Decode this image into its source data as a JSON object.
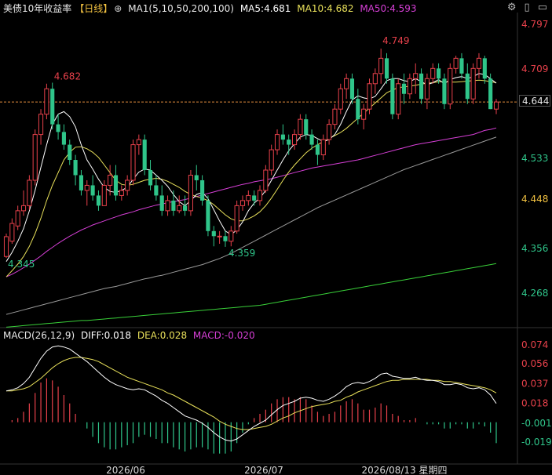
{
  "header": {
    "title": "美债10年收益率",
    "period": "【日线】",
    "ma_label": "MA1(5,10,50,200,100)",
    "ma5": "MA5:4.681",
    "ma10": "MA10:4.682",
    "ma50": "MA50:4.593"
  },
  "toolbar": {
    "settings_icon": "gear-icon",
    "toggle_icon": "panel-toggle-icon",
    "expand_icon": "expand-icon"
  },
  "macd_header": {
    "label": "MACD(26,12,9)",
    "diff": "DIFF:0.018",
    "dea": "DEA:0.028",
    "macd": "MACD:-0.020"
  },
  "last_price_tag": "4.644",
  "lower_tag": "4.448",
  "annotations": {
    "high1": "4.682",
    "low1": "4.345",
    "low2": "4.359",
    "high2": "4.749"
  },
  "x_labels": [
    "2026/06",
    "2026/07",
    "2026/08/13 星期四"
  ],
  "colors": {
    "up": "#e8414b",
    "down": "#2fc58a",
    "ma5": "#ffffff",
    "ma10": "#e8e05a",
    "ma50": "#d63fd6",
    "ma200": "#9a9a9a",
    "ma100": "#39d039",
    "dea": "#e8e05a",
    "diff": "#ffffff",
    "axis_up": "#e8414b",
    "axis_down": "#2fc58a"
  },
  "chart_data": [
    {
      "type": "candlestick",
      "title": "美债10年收益率",
      "y_ticks": [
        4.797,
        4.709,
        4.644,
        4.533,
        4.448,
        4.356,
        4.268
      ],
      "ylim": [
        4.2,
        4.82
      ],
      "reference_line": 4.644,
      "ohlc": [
        [
          4.34,
          4.385,
          4.337,
          4.379
        ],
        [
          4.37,
          4.415,
          4.365,
          4.405
        ],
        [
          4.4,
          4.44,
          4.392,
          4.43
        ],
        [
          4.43,
          4.47,
          4.42,
          4.44
        ],
        [
          4.44,
          4.5,
          4.432,
          4.49
        ],
        [
          4.49,
          4.59,
          4.48,
          4.58
        ],
        [
          4.58,
          4.63,
          4.56,
          4.62
        ],
        [
          4.62,
          4.68,
          4.61,
          4.67
        ],
        [
          4.67,
          4.682,
          4.59,
          4.6
        ],
        [
          4.6,
          4.62,
          4.57,
          4.585
        ],
        [
          4.585,
          4.6,
          4.55,
          4.56
        ],
        [
          4.56,
          4.57,
          4.52,
          4.53
        ],
        [
          4.53,
          4.54,
          4.48,
          4.5
        ],
        [
          4.5,
          4.51,
          4.46,
          4.47
        ],
        [
          4.47,
          4.49,
          4.44,
          4.48
        ],
        [
          4.48,
          4.5,
          4.45,
          4.46
        ],
        [
          4.46,
          4.47,
          4.43,
          4.44
        ],
        [
          4.44,
          4.49,
          4.44,
          4.48
        ],
        [
          4.48,
          4.52,
          4.46,
          4.5
        ],
        [
          4.5,
          4.52,
          4.45,
          4.46
        ],
        [
          4.46,
          4.48,
          4.45,
          4.47
        ],
        [
          4.47,
          4.5,
          4.46,
          4.49
        ],
        [
          4.49,
          4.57,
          4.48,
          4.56
        ],
        [
          4.56,
          4.58,
          4.54,
          4.57
        ],
        [
          4.57,
          4.58,
          4.5,
          4.51
        ],
        [
          4.51,
          4.53,
          4.47,
          4.48
        ],
        [
          4.48,
          4.5,
          4.45,
          4.46
        ],
        [
          4.46,
          4.48,
          4.42,
          4.43
        ],
        [
          4.43,
          4.46,
          4.42,
          4.45
        ],
        [
          4.45,
          4.47,
          4.42,
          4.43
        ],
        [
          4.43,
          4.46,
          4.425,
          4.44
        ],
        [
          4.44,
          4.46,
          4.42,
          4.43
        ],
        [
          4.43,
          4.51,
          4.42,
          4.5
        ],
        [
          4.5,
          4.52,
          4.47,
          4.49
        ],
        [
          4.49,
          4.5,
          4.44,
          4.45
        ],
        [
          4.45,
          4.46,
          4.38,
          4.39
        ],
        [
          4.39,
          4.4,
          4.36,
          4.38
        ],
        [
          4.38,
          4.39,
          4.365,
          4.38
        ],
        [
          4.38,
          4.39,
          4.359,
          4.37
        ],
        [
          4.37,
          4.4,
          4.36,
          4.39
        ],
        [
          4.39,
          4.45,
          4.385,
          4.44
        ],
        [
          4.44,
          4.46,
          4.43,
          4.45
        ],
        [
          4.45,
          4.47,
          4.44,
          4.46
        ],
        [
          4.46,
          4.47,
          4.44,
          4.45
        ],
        [
          4.45,
          4.48,
          4.44,
          4.47
        ],
        [
          4.47,
          4.52,
          4.465,
          4.51
        ],
        [
          4.51,
          4.56,
          4.5,
          4.55
        ],
        [
          4.55,
          4.59,
          4.54,
          4.58
        ],
        [
          4.58,
          4.6,
          4.56,
          4.57
        ],
        [
          4.57,
          4.58,
          4.54,
          4.56
        ],
        [
          4.56,
          4.59,
          4.55,
          4.58
        ],
        [
          4.58,
          4.62,
          4.57,
          4.61
        ],
        [
          4.61,
          4.62,
          4.57,
          4.58
        ],
        [
          4.58,
          4.59,
          4.55,
          4.56
        ],
        [
          4.56,
          4.57,
          4.52,
          4.54
        ],
        [
          4.54,
          4.58,
          4.53,
          4.57
        ],
        [
          4.57,
          4.61,
          4.56,
          4.6
        ],
        [
          4.6,
          4.64,
          4.59,
          4.63
        ],
        [
          4.63,
          4.68,
          4.62,
          4.67
        ],
        [
          4.67,
          4.7,
          4.65,
          4.69
        ],
        [
          4.69,
          4.7,
          4.64,
          4.65
        ],
        [
          4.65,
          4.67,
          4.6,
          4.61
        ],
        [
          4.61,
          4.64,
          4.59,
          4.63
        ],
        [
          4.63,
          4.69,
          4.62,
          4.68
        ],
        [
          4.68,
          4.71,
          4.66,
          4.7
        ],
        [
          4.7,
          4.749,
          4.68,
          4.73
        ],
        [
          4.73,
          4.74,
          4.68,
          4.69
        ],
        [
          4.69,
          4.7,
          4.61,
          4.62
        ],
        [
          4.62,
          4.69,
          4.61,
          4.68
        ],
        [
          4.68,
          4.7,
          4.64,
          4.66
        ],
        [
          4.66,
          4.7,
          4.65,
          4.69
        ],
        [
          4.69,
          4.72,
          4.66,
          4.7
        ],
        [
          4.7,
          4.71,
          4.64,
          4.65
        ],
        [
          4.65,
          4.7,
          4.63,
          4.69
        ],
        [
          4.69,
          4.72,
          4.68,
          4.71
        ],
        [
          4.71,
          4.72,
          4.68,
          4.69
        ],
        [
          4.69,
          4.7,
          4.63,
          4.64
        ],
        [
          4.64,
          4.72,
          4.63,
          4.71
        ],
        [
          4.71,
          4.735,
          4.7,
          4.73
        ],
        [
          4.73,
          4.74,
          4.69,
          4.7
        ],
        [
          4.7,
          4.72,
          4.64,
          4.65
        ],
        [
          4.65,
          4.72,
          4.64,
          4.71
        ],
        [
          4.71,
          4.74,
          4.69,
          4.73
        ],
        [
          4.73,
          4.735,
          4.68,
          4.69
        ],
        [
          4.69,
          4.7,
          4.63,
          4.63
        ],
        [
          4.63,
          4.65,
          4.62,
          4.644
        ]
      ],
      "ma5": [
        4.33,
        4.348,
        4.37,
        4.395,
        4.43,
        4.47,
        4.515,
        4.56,
        4.6,
        4.62,
        4.625,
        4.615,
        4.595,
        4.56,
        4.53,
        4.512,
        4.492,
        4.476,
        4.468,
        4.466,
        4.47,
        4.476,
        4.492,
        4.506,
        4.512,
        4.51,
        4.5,
        4.49,
        4.478,
        4.462,
        4.448,
        4.44,
        4.45,
        4.462,
        4.466,
        4.454,
        4.432,
        4.41,
        4.39,
        4.383,
        4.392,
        4.408,
        4.43,
        4.445,
        4.455,
        4.47,
        4.49,
        4.51,
        4.53,
        4.548,
        4.562,
        4.575,
        4.58,
        4.578,
        4.572,
        4.566,
        4.57,
        4.58,
        4.6,
        4.625,
        4.648,
        4.656,
        4.652,
        4.65,
        4.655,
        4.67,
        4.686,
        4.69,
        4.69,
        4.686,
        4.684,
        4.69,
        4.684,
        4.678,
        4.682,
        4.688,
        4.68,
        4.688,
        4.692,
        4.694,
        4.69,
        4.694,
        4.7,
        4.698,
        4.69,
        4.681
      ],
      "ma10": [
        4.3,
        4.312,
        4.325,
        4.34,
        4.36,
        4.385,
        4.415,
        4.45,
        4.48,
        4.505,
        4.53,
        4.545,
        4.555,
        4.556,
        4.552,
        4.545,
        4.535,
        4.52,
        4.505,
        4.49,
        4.482,
        4.48,
        4.482,
        4.486,
        4.49,
        4.492,
        4.494,
        4.492,
        4.488,
        4.482,
        4.476,
        4.468,
        4.462,
        4.458,
        4.455,
        4.45,
        4.442,
        4.432,
        4.422,
        4.414,
        4.41,
        4.41,
        4.414,
        4.42,
        4.428,
        4.44,
        4.455,
        4.472,
        4.49,
        4.506,
        4.52,
        4.532,
        4.544,
        4.553,
        4.56,
        4.566,
        4.572,
        4.578,
        4.584,
        4.592,
        4.602,
        4.612,
        4.622,
        4.632,
        4.642,
        4.652,
        4.662,
        4.668,
        4.672,
        4.674,
        4.675,
        4.677,
        4.679,
        4.681,
        4.682,
        4.684,
        4.684,
        4.683,
        4.683,
        4.684,
        4.685,
        4.686,
        4.687,
        4.686,
        4.684,
        4.682
      ],
      "ma50": [
        4.3,
        4.305,
        4.311,
        4.318,
        4.325,
        4.333,
        4.341,
        4.35,
        4.358,
        4.366,
        4.373,
        4.38,
        4.386,
        4.392,
        4.397,
        4.402,
        4.406,
        4.41,
        4.414,
        4.418,
        4.422,
        4.425,
        4.428,
        4.432,
        4.435,
        4.438,
        4.441,
        4.443,
        4.446,
        4.448,
        4.45,
        4.452,
        4.455,
        4.458,
        4.461,
        4.464,
        4.467,
        4.47,
        4.473,
        4.476,
        4.479,
        4.482,
        4.484,
        4.487,
        4.489,
        4.491,
        4.493,
        4.496,
        4.499,
        4.502,
        4.505,
        4.508,
        4.511,
        4.514,
        4.516,
        4.518,
        4.52,
        4.522,
        4.524,
        4.526,
        4.528,
        4.53,
        4.533,
        4.536,
        4.539,
        4.542,
        4.545,
        4.548,
        4.551,
        4.554,
        4.557,
        4.56,
        4.562,
        4.564,
        4.566,
        4.568,
        4.57,
        4.572,
        4.574,
        4.576,
        4.578,
        4.58,
        4.584,
        4.588,
        4.59,
        4.593
      ],
      "ma200": [
        4.226,
        4.229,
        4.232,
        4.235,
        4.238,
        4.241,
        4.244,
        4.247,
        4.25,
        4.253,
        4.256,
        4.259,
        4.262,
        4.265,
        4.268,
        4.271,
        4.274,
        4.277,
        4.279,
        4.281,
        4.284,
        4.287,
        4.29,
        4.293,
        4.296,
        4.298,
        4.301,
        4.303,
        4.306,
        4.309,
        4.312,
        4.315,
        4.318,
        4.321,
        4.324,
        4.328,
        4.332,
        4.336,
        4.341,
        4.346,
        4.352,
        4.358,
        4.364,
        4.37,
        4.376,
        4.382,
        4.388,
        4.394,
        4.4,
        4.406,
        4.412,
        4.418,
        4.424,
        4.43,
        4.436,
        4.441,
        4.446,
        4.451,
        4.456,
        4.461,
        4.466,
        4.471,
        4.476,
        4.481,
        4.486,
        4.491,
        4.496,
        4.501,
        4.506,
        4.511,
        4.515,
        4.519,
        4.523,
        4.527,
        4.531,
        4.535,
        4.539,
        4.543,
        4.547,
        4.551,
        4.555,
        4.559,
        4.563,
        4.567,
        4.571,
        4.575
      ],
      "ma100": [
        4.201,
        4.202,
        4.203,
        4.204,
        4.205,
        4.206,
        4.207,
        4.208,
        4.209,
        4.21,
        4.211,
        4.212,
        4.213,
        4.214,
        4.214,
        4.215,
        4.216,
        4.217,
        4.218,
        4.219,
        4.22,
        4.221,
        4.222,
        4.223,
        4.224,
        4.225,
        4.226,
        4.227,
        4.228,
        4.229,
        4.23,
        4.231,
        4.232,
        4.233,
        4.234,
        4.235,
        4.236,
        4.237,
        4.238,
        4.239,
        4.24,
        4.241,
        4.242,
        4.243,
        4.244,
        4.246,
        4.248,
        4.25,
        4.252,
        4.254,
        4.256,
        4.258,
        4.26,
        4.262,
        4.264,
        4.266,
        4.268,
        4.27,
        4.272,
        4.274,
        4.276,
        4.278,
        4.28,
        4.282,
        4.284,
        4.286,
        4.288,
        4.29,
        4.292,
        4.294,
        4.296,
        4.298,
        4.3,
        4.302,
        4.304,
        4.306,
        4.308,
        4.31,
        4.312,
        4.314,
        4.316,
        4.318,
        4.32,
        4.322,
        4.324,
        4.326
      ]
    },
    {
      "type": "macd",
      "title": "MACD(26,12,9)",
      "y_ticks": [
        0.074,
        0.056,
        0.037,
        0.018,
        -0.001,
        -0.019
      ],
      "ylim": [
        -0.04,
        0.08
      ],
      "diff": [
        0.03,
        0.031,
        0.033,
        0.037,
        0.043,
        0.052,
        0.061,
        0.068,
        0.072,
        0.073,
        0.072,
        0.07,
        0.066,
        0.062,
        0.058,
        0.053,
        0.048,
        0.043,
        0.039,
        0.036,
        0.034,
        0.032,
        0.031,
        0.032,
        0.031,
        0.028,
        0.025,
        0.021,
        0.018,
        0.014,
        0.01,
        0.006,
        0.004,
        0.002,
        -0.001,
        -0.005,
        -0.01,
        -0.014,
        -0.017,
        -0.018,
        -0.016,
        -0.012,
        -0.008,
        -0.004,
        -0.001,
        0.002,
        0.007,
        0.012,
        0.016,
        0.018,
        0.02,
        0.023,
        0.024,
        0.023,
        0.021,
        0.02,
        0.022,
        0.025,
        0.029,
        0.034,
        0.037,
        0.038,
        0.037,
        0.039,
        0.042,
        0.046,
        0.047,
        0.044,
        0.043,
        0.042,
        0.042,
        0.043,
        0.041,
        0.04,
        0.04,
        0.039,
        0.036,
        0.036,
        0.037,
        0.036,
        0.033,
        0.032,
        0.033,
        0.031,
        0.026,
        0.018
      ],
      "dea": [
        0.03,
        0.03,
        0.031,
        0.032,
        0.034,
        0.038,
        0.042,
        0.047,
        0.052,
        0.056,
        0.059,
        0.061,
        0.062,
        0.062,
        0.061,
        0.06,
        0.058,
        0.055,
        0.052,
        0.049,
        0.046,
        0.043,
        0.041,
        0.039,
        0.037,
        0.035,
        0.033,
        0.031,
        0.028,
        0.026,
        0.023,
        0.02,
        0.017,
        0.014,
        0.011,
        0.008,
        0.005,
        0.001,
        -0.002,
        -0.004,
        -0.006,
        -0.007,
        -0.007,
        -0.006,
        -0.005,
        -0.004,
        -0.002,
        0.001,
        0.004,
        0.006,
        0.009,
        0.011,
        0.013,
        0.015,
        0.016,
        0.017,
        0.018,
        0.02,
        0.021,
        0.024,
        0.026,
        0.029,
        0.031,
        0.033,
        0.035,
        0.037,
        0.039,
        0.04,
        0.04,
        0.041,
        0.041,
        0.041,
        0.041,
        0.041,
        0.04,
        0.04,
        0.039,
        0.039,
        0.038,
        0.037,
        0.036,
        0.035,
        0.034,
        0.033,
        0.031,
        0.028
      ],
      "macd": [
        0.0,
        0.002,
        0.004,
        0.01,
        0.018,
        0.028,
        0.038,
        0.042,
        0.04,
        0.034,
        0.026,
        0.018,
        0.008,
        0.0,
        -0.006,
        -0.014,
        -0.02,
        -0.024,
        -0.026,
        -0.026,
        -0.024,
        -0.022,
        -0.02,
        -0.014,
        -0.012,
        -0.014,
        -0.016,
        -0.02,
        -0.02,
        -0.024,
        -0.026,
        -0.028,
        -0.026,
        -0.024,
        -0.024,
        -0.026,
        -0.03,
        -0.03,
        -0.03,
        -0.028,
        -0.02,
        -0.01,
        -0.002,
        0.004,
        0.008,
        0.012,
        0.018,
        0.022,
        0.024,
        0.024,
        0.022,
        0.024,
        0.022,
        0.016,
        0.01,
        0.006,
        0.008,
        0.01,
        0.016,
        0.02,
        0.022,
        0.018,
        0.012,
        0.012,
        0.014,
        0.018,
        0.016,
        0.008,
        0.006,
        0.002,
        0.002,
        0.004,
        0.0,
        -0.002,
        -0.002,
        -0.002,
        -0.006,
        -0.006,
        -0.002,
        -0.002,
        -0.006,
        -0.006,
        -0.002,
        -0.004,
        -0.01,
        -0.02
      ]
    }
  ]
}
